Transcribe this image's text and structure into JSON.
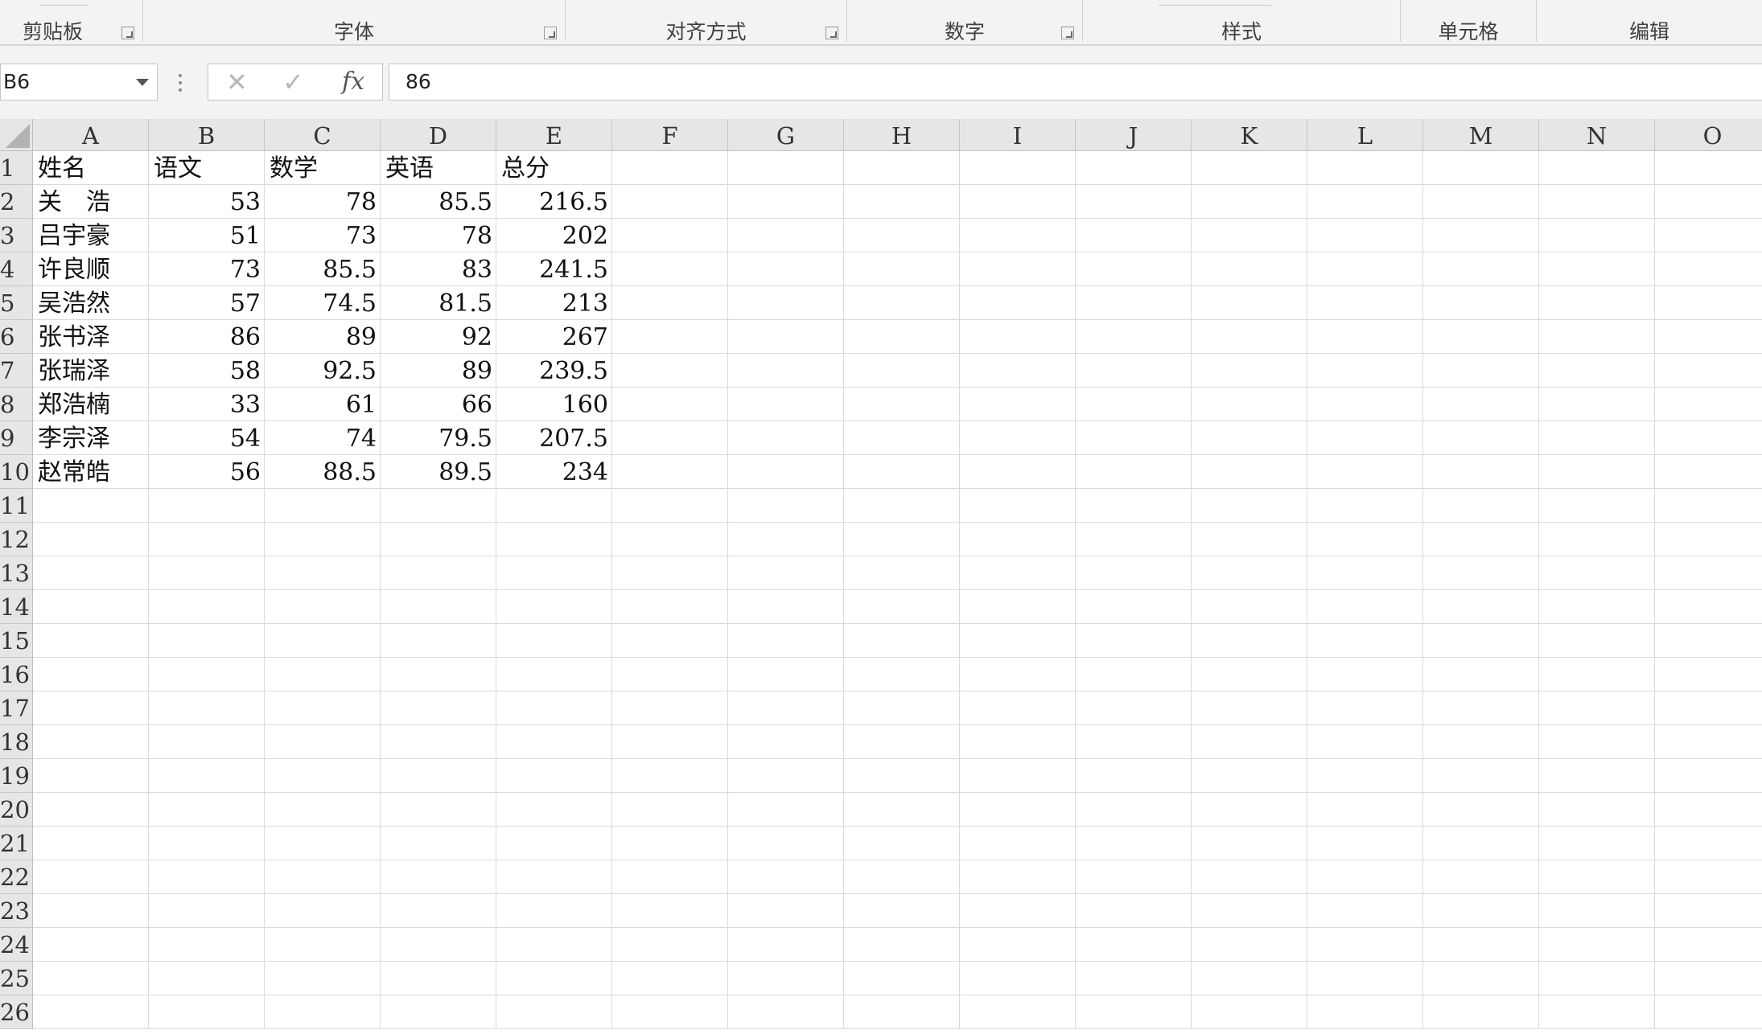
{
  "window": {
    "title": ""
  },
  "ribbon": {
    "groups": [
      {
        "label": "剪贴板",
        "launcher": true
      },
      {
        "label": "字体",
        "launcher": true
      },
      {
        "label": "对齐方式",
        "launcher": true
      },
      {
        "label": "数字",
        "launcher": true
      },
      {
        "label": "样式",
        "launcher": false
      },
      {
        "label": "单元格",
        "launcher": false
      },
      {
        "label": "编辑",
        "launcher": false
      }
    ]
  },
  "formula_bar": {
    "name_box": "B6",
    "cancel_icon": "close-icon",
    "enter_icon": "check-icon",
    "fx_label": "fx",
    "value": "86"
  },
  "sheet": {
    "column_headers": [
      "A",
      "B",
      "C",
      "D",
      "E",
      "F",
      "G",
      "H",
      "I",
      "J",
      "K",
      "L",
      "M",
      "N",
      "O"
    ],
    "row_headers": [
      "1",
      "2",
      "3",
      "4",
      "5",
      "6",
      "7",
      "8",
      "9",
      "10",
      "11",
      "12",
      "13",
      "14",
      "15",
      "16",
      "17",
      "18",
      "19",
      "20",
      "21",
      "22",
      "23",
      "24",
      "25",
      "26"
    ],
    "header_row": [
      "姓名",
      "语文",
      "数学",
      "英语",
      "总分"
    ],
    "data_rows": [
      [
        "关　浩",
        "53",
        "78",
        "85.5",
        "216.5"
      ],
      [
        "吕宇豪",
        "51",
        "73",
        "78",
        "202"
      ],
      [
        "许良顺",
        "73",
        "85.5",
        "83",
        "241.5"
      ],
      [
        "吴浩然",
        "57",
        "74.5",
        "81.5",
        "213"
      ],
      [
        "张书泽",
        "86",
        "89",
        "92",
        "267"
      ],
      [
        "张瑞泽",
        "58",
        "92.5",
        "89",
        "239.5"
      ],
      [
        "郑浩楠",
        "33",
        "61",
        "66",
        "160"
      ],
      [
        "李宗泽",
        "54",
        "74",
        "79.5",
        "207.5"
      ],
      [
        "赵常皓",
        "56",
        "88.5",
        "89.5",
        "234"
      ]
    ],
    "selected_cell": "B6"
  },
  "colors": {
    "header_bg": "#e6e6e6",
    "grid_line": "#dadada",
    "ribbon_bg": "#f3f3f3"
  }
}
